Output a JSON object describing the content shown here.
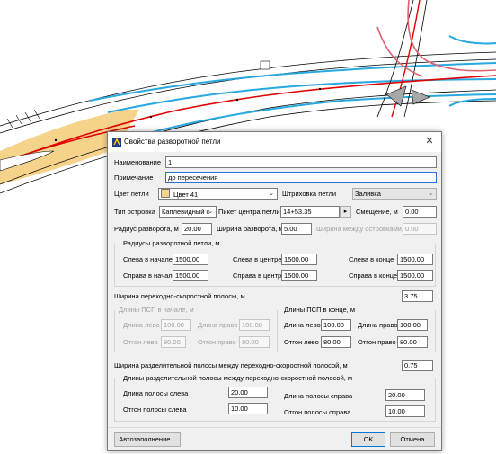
{
  "dialog": {
    "title": "Свойства разворотной петли",
    "close_label": "✕",
    "name": {
      "label": "Наименование",
      "value": "1"
    },
    "note": {
      "label": "Примечание",
      "value": "до пересечения"
    },
    "loop_color": {
      "label": "Цвет петли",
      "value": "Цвет 41",
      "swatch": "#f6d38a"
    },
    "hatch": {
      "label": "Штриховка петли",
      "value": "Заливка"
    },
    "island_type": {
      "label": "Тип островка",
      "value": "Каплевидный с"
    },
    "center_picket": {
      "label": "Пикет центра петли",
      "value": "14+53.35"
    },
    "offset": {
      "label": "Смещение, м",
      "value": "0.00"
    },
    "turn_radius": {
      "label": "Радиус разворота, м",
      "value": "20.00"
    },
    "turn_width": {
      "label": "Ширина разворота, м",
      "value": "5.00"
    },
    "island_width": {
      "label": "Ширина между островками, м",
      "value": "0.00"
    },
    "radii": {
      "title": "Радиусы разворотной петли, м",
      "left_start": {
        "label": "Слева в начале",
        "value": "1500.00"
      },
      "left_center": {
        "label": "Слева в центре",
        "value": "1500.00"
      },
      "left_end": {
        "label": "Слева в конце",
        "value": "1500.00"
      },
      "right_start": {
        "label": "Справа в начале",
        "value": "1500.00"
      },
      "right_center": {
        "label": "Справа в центре",
        "value": "1500.00"
      },
      "right_end": {
        "label": "Справа в конце",
        "value": "1500.00"
      }
    },
    "speed_lane": {
      "label": "Ширина переходно-скоростной полосы, м",
      "value": "3.75"
    },
    "psp_start": {
      "title": "Длины ПСП в начале, м",
      "len_left": {
        "label": "Длина лево",
        "value": "100.00"
      },
      "len_right": {
        "label": "Длина право",
        "value": "100.00"
      },
      "off_left": {
        "label": "Отгон лево",
        "value": "80.00"
      },
      "off_right": {
        "label": "Отгон право",
        "value": "80.00"
      }
    },
    "psp_end": {
      "title": "Длины ПСП в конце, м",
      "len_left": {
        "label": "Длина лево",
        "value": "100.00"
      },
      "len_right": {
        "label": "Длина право",
        "value": "100.00"
      },
      "off_left": {
        "label": "Отгон лево",
        "value": "80.00"
      },
      "off_right": {
        "label": "Отгон право",
        "value": "80.00"
      }
    },
    "divider_width": {
      "label": "Ширина разделительной полосы между переходно-скоростной полосой, м",
      "value": "0.75"
    },
    "divider_lengths": {
      "title": "Длины разделительной полосы между переходно-скоростной полосой, м",
      "len_left": {
        "label": "Длина полосы слева",
        "value": "20.00"
      },
      "off_left": {
        "label": "Отгон полосы слева",
        "value": "10.00"
      },
      "len_right": {
        "label": "Длина полосы справа",
        "value": "20.00"
      },
      "off_right": {
        "label": "Отгон полосы справа",
        "value": "10.00"
      }
    },
    "buttons": {
      "autofill": "Автозаполнение...",
      "ok": "OK",
      "cancel": "Отмена"
    }
  },
  "colors": {
    "road_fill": "#f6d38a",
    "axis": "#e00000",
    "lane": "#28a8e0",
    "island": "#a0a0a0"
  }
}
